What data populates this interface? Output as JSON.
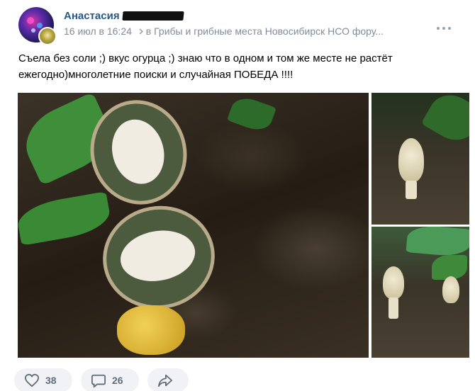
{
  "post": {
    "author": "Анастасия У",
    "date": "16 июл в 16:24",
    "group": "в Грибы и грибные места Новосибирск НСО фору...",
    "text_line1": "Съела без соли ;) вкус огурца ;) знаю что в одном и том же месте не растёт",
    "text_line2": "ежегодно)многолетние поиски и случайная ПОБЕДА !!!!"
  },
  "actions": {
    "likes": "38",
    "comments": "26"
  },
  "icons": {
    "more": "more-dots-icon",
    "like": "heart-icon",
    "comment": "comment-icon",
    "share": "share-arrow-icon",
    "group_arrow": "chevron-right-icon"
  },
  "colors": {
    "author": "#2a5885",
    "meta": "#818c99",
    "pill_bg": "#f0f2f5",
    "icon": "#626d7a"
  }
}
